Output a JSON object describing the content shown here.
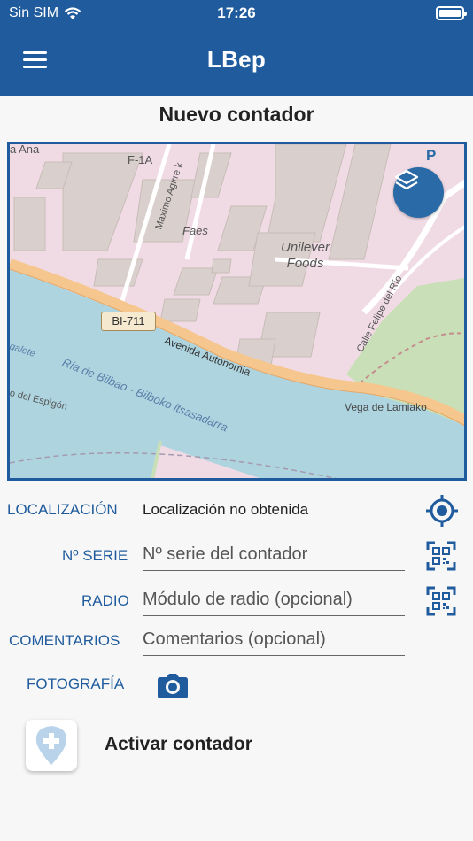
{
  "status_bar": {
    "carrier": "Sin SIM",
    "time": "17:26"
  },
  "nav": {
    "title": "LBep"
  },
  "page": {
    "title": "Nuevo contador"
  },
  "map": {
    "labels": {
      "f1a": "F-1A",
      "maximo": "Maximo Agirre k",
      "faes": "Faes",
      "unilever": "Unilever\nFoods",
      "calle_felipe": "Calle Felipe del Río",
      "avenida": "Avenida Autonomia",
      "ria": "Ría de Bilbao - Bilboko itsasadarra",
      "vega": "Vega de Lamiako",
      "espigon": "o del Espigón",
      "galete": "galete",
      "ana": "a Ana",
      "road_badge": "BI-711",
      "parking": "P"
    }
  },
  "form": {
    "localizacion": {
      "label": "LOCALIZACIÓN",
      "value": "Localización no obtenida"
    },
    "serie": {
      "label": "Nº SERIE",
      "placeholder": "Nº serie del contador"
    },
    "radio": {
      "label": "RADIO",
      "placeholder": "Módulo de radio (opcional)"
    },
    "comentarios": {
      "label": "COMENTARIOS",
      "placeholder": "Comentarios (opcional)"
    },
    "fotografia": {
      "label": "FOTOGRAFÍA"
    }
  },
  "action": {
    "label": "Activar contador"
  },
  "colors": {
    "primary": "#1f5b9d",
    "map_land": "#f0dbe5",
    "map_water": "#aed4e0",
    "map_road": "#f5c78f",
    "map_park": "#c9dfb7"
  },
  "icons": {
    "menu": "hamburger-icon",
    "layers": "layers-icon",
    "gps": "crosshair-icon",
    "qr": "qr-code-icon",
    "camera": "camera-icon",
    "add_pin": "map-pin-plus-icon"
  }
}
